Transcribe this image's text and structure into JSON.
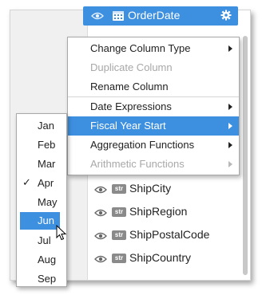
{
  "columns_panel": {
    "selected_column": {
      "name": "OrderDate",
      "type_icon": "calendar-icon",
      "settings_icon": "gear-icon"
    },
    "columns": [
      {
        "type": "str",
        "name": "ShipCity"
      },
      {
        "type": "str",
        "name": "ShipRegion"
      },
      {
        "type": "str",
        "name": "ShipPostalCode"
      },
      {
        "type": "str",
        "name": "ShipCountry"
      }
    ]
  },
  "context_menu": {
    "items": [
      {
        "label": "Change Column Type",
        "has_submenu": true,
        "enabled": true
      },
      {
        "label": "Duplicate Column",
        "has_submenu": false,
        "enabled": false
      },
      {
        "label": "Rename Column",
        "has_submenu": false,
        "enabled": true
      },
      {
        "label": "Date Expressions",
        "has_submenu": true,
        "enabled": true
      },
      {
        "label": "Fiscal Year Start",
        "has_submenu": true,
        "enabled": true,
        "highlighted": true
      },
      {
        "label": "Aggregation Functions",
        "has_submenu": true,
        "enabled": true
      },
      {
        "label": "Arithmetic Functions",
        "has_submenu": true,
        "enabled": false
      }
    ]
  },
  "month_submenu": {
    "checked": "Apr",
    "hovered": "Jun",
    "months": [
      "Jan",
      "Feb",
      "Mar",
      "Apr",
      "May",
      "Jun",
      "Jul",
      "Aug",
      "Sep"
    ],
    "check_glyph": "✓"
  },
  "colors": {
    "accent": "#3d8fe0",
    "disabled_text": "#a8a8a8"
  }
}
